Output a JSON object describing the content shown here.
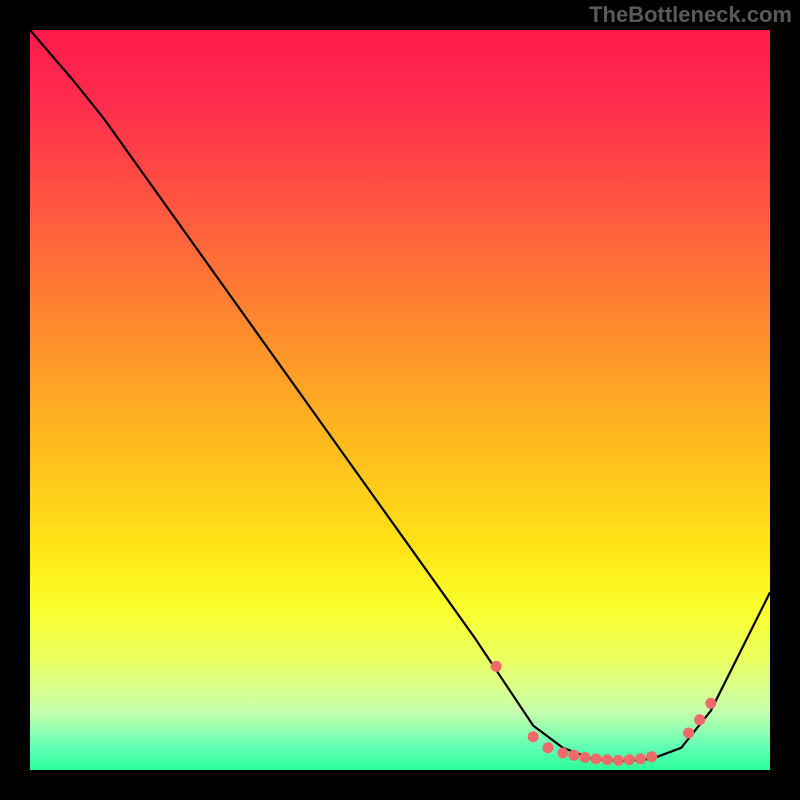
{
  "watermark": "TheBottleneck.com",
  "chart_data": {
    "type": "line",
    "title": "",
    "xlabel": "",
    "ylabel": "",
    "xlim": [
      0,
      100
    ],
    "ylim": [
      0,
      100
    ],
    "series": [
      {
        "name": "curve",
        "x": [
          0,
          6,
          10,
          20,
          30,
          40,
          50,
          60,
          64,
          68,
          72,
          76,
          80,
          84,
          88,
          92,
          100
        ],
        "y": [
          100,
          93,
          88,
          74,
          60,
          46,
          32,
          18,
          12,
          6,
          3,
          1.5,
          1.2,
          1.5,
          3,
          8,
          24
        ]
      }
    ],
    "markers": {
      "name": "dots",
      "color": "#f06a6a",
      "x": [
        63,
        68,
        70,
        72,
        73.5,
        75,
        76.5,
        78,
        79.5,
        81,
        82.5,
        84,
        89,
        90.5,
        92
      ],
      "y": [
        14,
        4.5,
        3,
        2.3,
        2,
        1.7,
        1.5,
        1.4,
        1.3,
        1.4,
        1.5,
        1.8,
        5,
        6.8,
        9
      ]
    },
    "gradient_stops": [
      {
        "pos": 0,
        "color": "#ff1a4a"
      },
      {
        "pos": 25,
        "color": "#ff5a3f"
      },
      {
        "pos": 55,
        "color": "#ffb81f"
      },
      {
        "pos": 78,
        "color": "#faff2a"
      },
      {
        "pos": 97,
        "color": "#5fffb5"
      },
      {
        "pos": 100,
        "color": "#2bff98"
      }
    ]
  }
}
